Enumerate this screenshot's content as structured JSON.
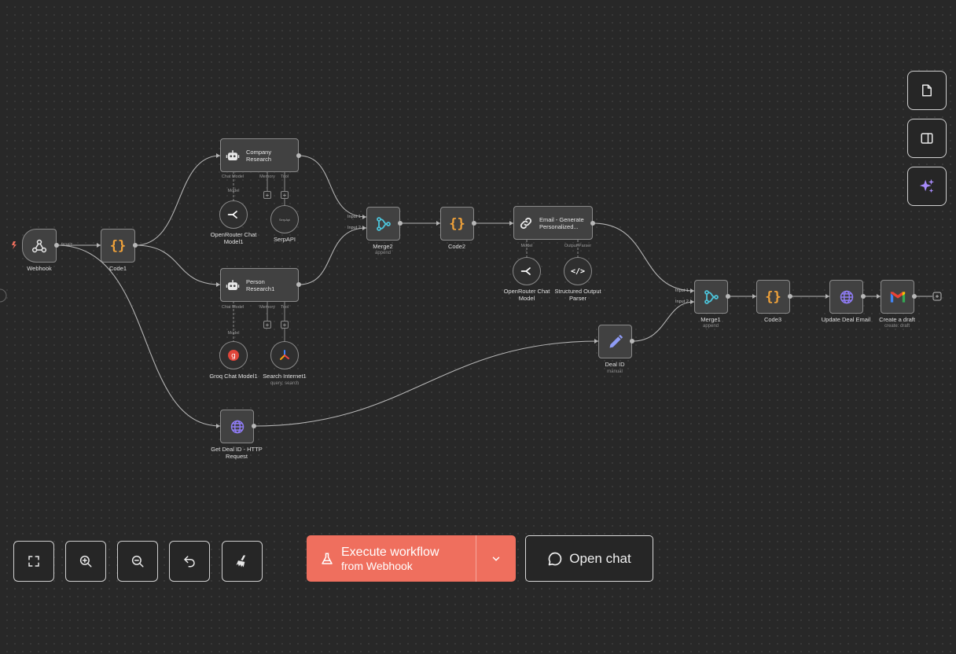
{
  "nodes": {
    "webhook": {
      "title": "Webhook",
      "port_label": "POST"
    },
    "code1": {
      "title": "Code1"
    },
    "company_research": {
      "title": "Company Research",
      "port_chat_model": "Chat Model",
      "port_memory": "Memory",
      "port_tool": "Tool",
      "port_model": "Model"
    },
    "openrouter1": {
      "title": "OpenRouter Chat Model1"
    },
    "serpapi": {
      "title": "SerpAPI",
      "glyph": "SerpApi"
    },
    "person_research": {
      "title": "Person Research1",
      "port_chat_model": "Chat Model",
      "port_memory": "Memory",
      "port_tool": "Tool",
      "port_model": "Model"
    },
    "groq": {
      "title": "Groq Chat Model1"
    },
    "search_internet": {
      "title": "Search Internet1",
      "subtitle": "query: search"
    },
    "merge2": {
      "title": "Merge2",
      "subtitle": "append",
      "input1": "Input 1",
      "input2": "Input 2"
    },
    "code2": {
      "title": "Code2"
    },
    "email_generate": {
      "title": "Email - Generate Personalized...",
      "port_model": "Model",
      "port_parser": "Output Parser"
    },
    "openrouter2": {
      "title": "OpenRouter Chat Model"
    },
    "structured_parser": {
      "title": "Structured Output Parser"
    },
    "get_deal_id": {
      "title": "Get Deal ID - HTTP Request"
    },
    "deal_id": {
      "title": "Deal ID",
      "subtitle": "manual"
    },
    "merge1": {
      "title": "Merge1",
      "subtitle": "append",
      "input1": "Input 1",
      "input2": "Input 2"
    },
    "code3": {
      "title": "Code3"
    },
    "update_deal": {
      "title": "Update Deal Email"
    },
    "create_draft": {
      "title": "Create a draft",
      "subtitle": "create: draft"
    }
  },
  "side_toolbar": {
    "icons": [
      "sticky-note-icon",
      "panel-toggle-icon",
      "ai-sparkle-icon"
    ]
  },
  "bottom_toolbar": {
    "icons": [
      "fit-view-icon",
      "zoom-in-icon",
      "zoom-out-icon",
      "undo-icon",
      "tidy-up-icon"
    ]
  },
  "execute": {
    "label": "Execute workflow",
    "sublabel_prefix": "from ",
    "sublabel_target": "Webhook"
  },
  "open_chat": {
    "label": "Open chat"
  },
  "colors": {
    "background": "#282828",
    "node": "#414141",
    "accent": "#ef6f5e",
    "code_icon": "#f0a23a",
    "merge_icon": "#4cc3d9",
    "globe_icon": "#8f7cf5"
  }
}
